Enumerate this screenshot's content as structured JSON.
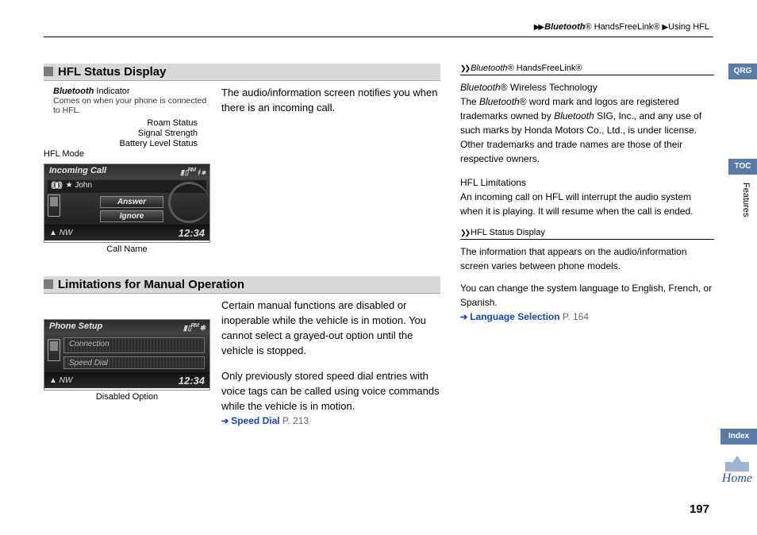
{
  "header": {
    "breadcrumb": {
      "bluetooth": "Bluetooth",
      "reg": "®",
      "handsfree": " HandsFreeLink®",
      "sep": " ▶ ",
      "using": "Using HFL"
    }
  },
  "section1": {
    "title": "HFL Status Display",
    "callouts": {
      "bt_indicator_label": "Bluetooth",
      "bt_indicator_word": " Indicator",
      "bt_indicator_desc": "Comes on when your phone is connected to HFL.",
      "roam": "Roam Status",
      "signal": "Signal Strength",
      "battery": "Battery Level Status",
      "hflmode": "HFL Mode"
    },
    "screen": {
      "title_left": "Incoming Call",
      "caller": "John",
      "answer": "Answer",
      "ignore": "Ignore",
      "clock": "12:34",
      "compass": "▲ NW"
    },
    "below_caption": "Call Name",
    "paragraph": "The audio/information screen notifies you when there is an incoming call."
  },
  "section2": {
    "title": "Limitations for Manual Operation",
    "screen": {
      "title_left": "Phone Setup",
      "item1": "Connection",
      "item2": "Speed Dial",
      "clock": "12:34",
      "compass": "▲ NW"
    },
    "below_caption": "Disabled Option",
    "paragraph1": "Certain manual functions are disabled or inoperable while the vehicle is in motion. You cannot select a grayed-out option until the vehicle is stopped.",
    "paragraph2": "Only previously stored speed dial entries with voice tags can be called using voice commands while the vehicle is in motion.",
    "link": {
      "label": "Speed Dial",
      "page": "P. 213"
    }
  },
  "sidebar": {
    "head1_bt": "Bluetooth",
    "head1_rest": "® HandsFreeLink®",
    "sub1_bt": "Bluetooth",
    "sub1_rest": "® Wireless Technology",
    "para1": "The Bluetooth® word mark and logos are registered trademarks owned by Bluetooth SIG, Inc., and any use of such marks by Honda Motors Co., Ltd., is under license. Other trademarks and trade names are those of their respective owners.",
    "sub2": "HFL Limitations",
    "para2": "An incoming call on HFL will interrupt the audio system when it is playing. It will resume when the call is ended.",
    "head2": "HFL Status Display",
    "para3": "The information that appears on the audio/information screen varies between phone models.",
    "para4": "You can change the system language to English, French, or Spanish.",
    "link": {
      "label": "Language Selection",
      "page": "P. 164"
    }
  },
  "nav": {
    "qrg": "QRG",
    "toc": "TOC",
    "features": "Features",
    "index": "Index",
    "home": "Home"
  },
  "pagenum": "197"
}
